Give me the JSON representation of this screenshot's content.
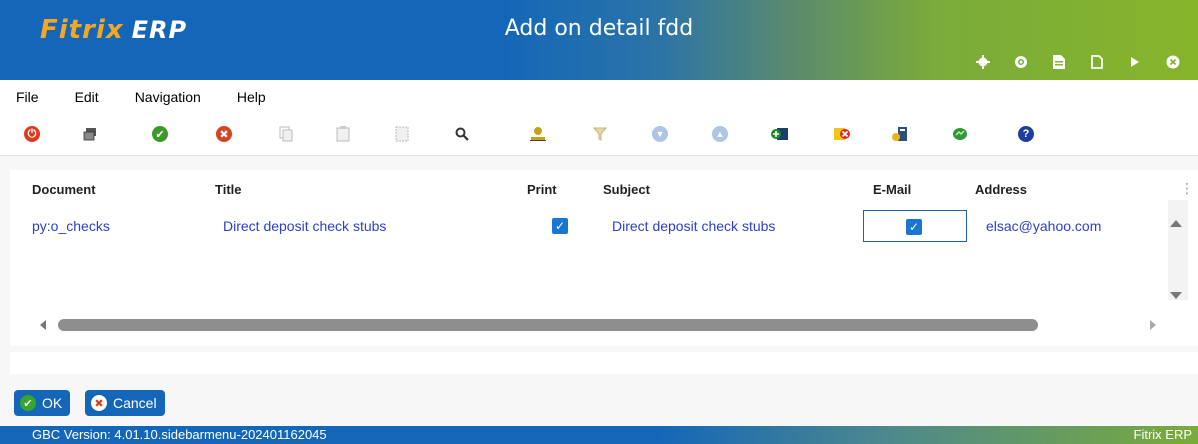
{
  "header": {
    "logo_main": "Fitrix",
    "logo_suffix": "ERP",
    "title": "Add on detail fdd",
    "icons": [
      "gear-icon",
      "globe-icon",
      "document-icon",
      "new-page-icon",
      "play-icon",
      "close-circle-icon"
    ]
  },
  "menu": {
    "items": [
      "File",
      "Edit",
      "Navigation",
      "Help"
    ]
  },
  "toolbar": {
    "icons": [
      "power-icon",
      "copy-screen-icon",
      "accept-icon",
      "cancel-icon",
      "copy-icon",
      "paste-icon",
      "select-all-icon",
      "search-icon",
      "user-lookup-icon",
      "filter-icon",
      "arrow-down-icon",
      "arrow-up-icon",
      "add-row-icon",
      "delete-row-icon",
      "edit-row-icon",
      "chat-icon",
      "help-icon"
    ]
  },
  "table": {
    "headers": {
      "document": "Document",
      "title": "Title",
      "print": "Print",
      "subject": "Subject",
      "email": "E-Mail",
      "address": "Address"
    },
    "rows": [
      {
        "document": "py:o_checks",
        "title": "Direct deposit check stubs",
        "print": true,
        "subject": "Direct deposit check stubs",
        "email": true,
        "address": "elsac@yahoo.com"
      }
    ]
  },
  "buttons": {
    "ok": "OK",
    "cancel": "Cancel"
  },
  "status": {
    "version": "GBC Version: 4.01.10.sidebarmenu-202401162045",
    "brand": "Fitrix ERP"
  },
  "colors": {
    "brand_blue": "#1467b8",
    "brand_green": "#86b52b",
    "link_blue": "#2b3fd1",
    "checkbox_blue": "#1976d2"
  }
}
